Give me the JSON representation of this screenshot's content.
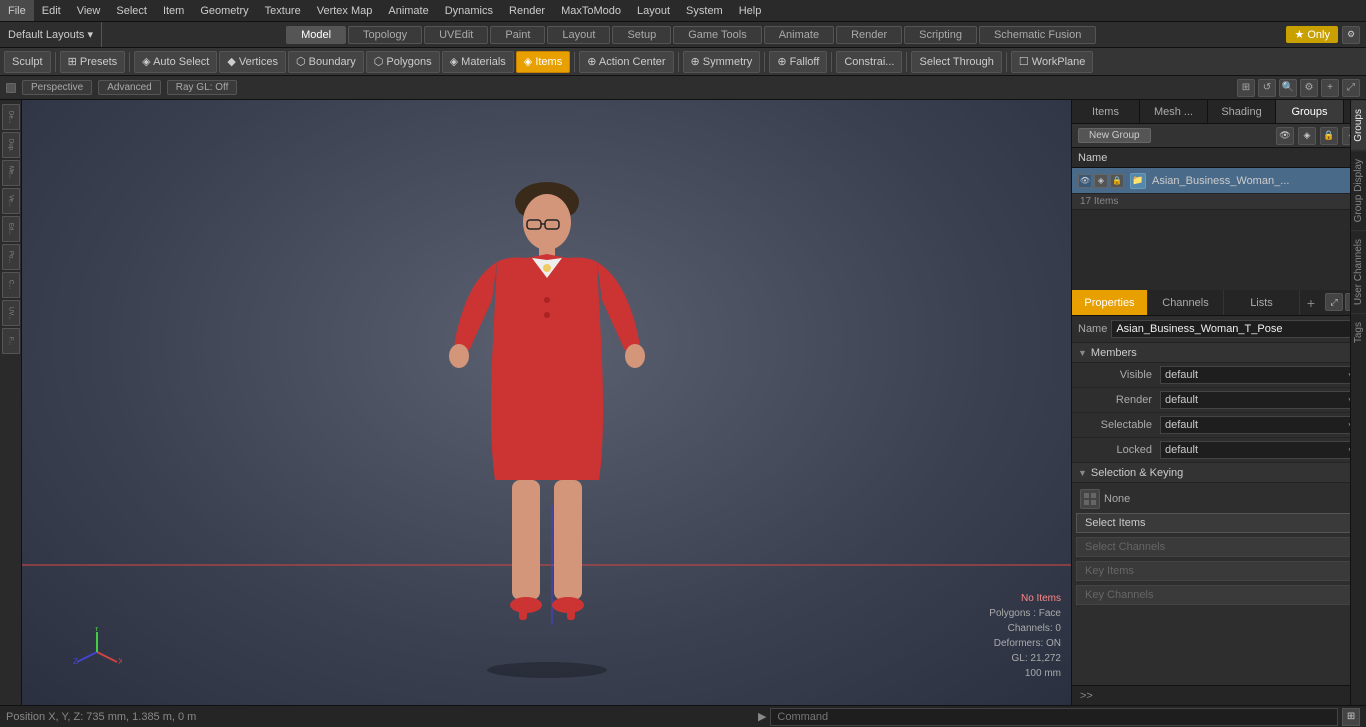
{
  "menubar": {
    "items": [
      "File",
      "Edit",
      "View",
      "Select",
      "Item",
      "Geometry",
      "Texture",
      "Vertex Map",
      "Animate",
      "Dynamics",
      "Render",
      "MaxToModo",
      "Layout",
      "System",
      "Help"
    ]
  },
  "layoutbar": {
    "left_label": "Default Layouts ▾",
    "tabs": [
      "Model",
      "Topology",
      "UVEdit",
      "Paint",
      "Layout",
      "Setup",
      "Game Tools",
      "Animate",
      "Render",
      "Scripting",
      "Schematic Fusion"
    ],
    "active_tab": "Model",
    "star_label": "★ Only",
    "plus_icon": "+"
  },
  "toolbar": {
    "sculpt_label": "Sculpt",
    "presets_label": "⊞ Presets",
    "auto_select_label": "◈ Auto Select",
    "vertices_label": "◆ Vertices",
    "boundary_label": "⬡ Boundary",
    "polygons_label": "⬡ Polygons",
    "materials_label": "◈ Materials",
    "items_label": "◈ Items",
    "action_center_label": "⊕ Action Center",
    "symmetry_label": "⊕ Symmetry",
    "falloff_label": "⊕ Falloff",
    "constraints_label": "Constrai...",
    "select_through_label": "Select Through",
    "workplane_label": "☐ WorkPlane"
  },
  "viewport": {
    "perspective_label": "Perspective",
    "advanced_label": "Advanced",
    "ray_gl_label": "Ray GL: Off",
    "stats": {
      "no_items": "No Items",
      "polygons": "Polygons : Face",
      "channels": "Channels: 0",
      "deformers": "Deformers: ON",
      "gl": "GL: 21,272",
      "size": "100 mm"
    },
    "position": "Position X, Y, Z:   735 mm, 1.385 m, 0 m"
  },
  "right_panel": {
    "top_tabs": [
      "Items",
      "Mesh ...",
      "Shading",
      "Groups"
    ],
    "active_top_tab": "Groups",
    "new_group_btn": "New Group",
    "scene_list": {
      "header": "Name",
      "items": [
        {
          "name": "Asian_Business_Woman_...",
          "count": "17 Items",
          "selected": true
        }
      ]
    },
    "props_tabs": [
      "Properties",
      "Channels",
      "Lists"
    ],
    "active_props_tab": "Properties",
    "name_field": {
      "label": "Name",
      "value": "Asian_Business_Woman_T_Pose"
    },
    "members_section": "Members",
    "members_fields": [
      {
        "label": "Visible",
        "value": "default"
      },
      {
        "label": "Render",
        "value": "default"
      },
      {
        "label": "Selectable",
        "value": "default"
      },
      {
        "label": "Locked",
        "value": "default"
      }
    ],
    "selection_section": "Selection & Keying",
    "keying_value": "None",
    "buttons": {
      "select_items": "Select Items",
      "select_channels": "Select Channels",
      "key_items": "Key Items",
      "key_channels": "Key Channels"
    },
    "side_tabs": [
      "Groups",
      "Group Display",
      "User Channels",
      "Tags"
    ]
  },
  "commandbar": {
    "label": "Command",
    "placeholder": "Command"
  },
  "statusbar": {
    "position": "Position X, Y, Z:   735 mm, 1.385 m, 0 m"
  },
  "icons": {
    "eye": "👁",
    "lock": "🔒",
    "folder": "📁",
    "expand": "⤢",
    "arrow_right": "▶",
    "arrow_down": "▼",
    "arrow_left": "◀",
    "grid": "⊞",
    "settings": "⚙",
    "plus": "+",
    "chevron_down": "▾",
    "star": "★"
  }
}
